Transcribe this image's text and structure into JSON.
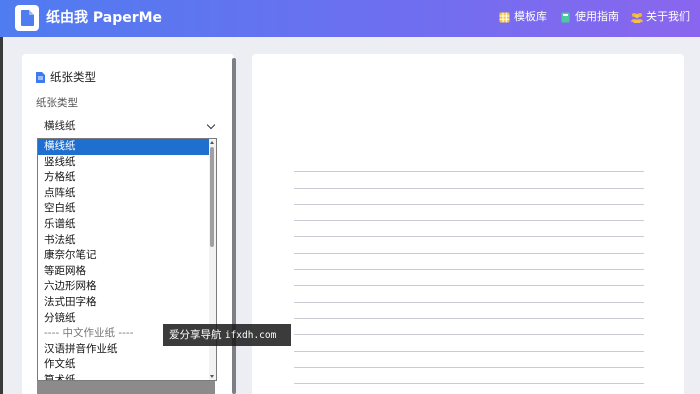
{
  "header": {
    "title": "纸由我 PaperMe",
    "nav": [
      {
        "label": "模板库",
        "icon": "grid-icon"
      },
      {
        "label": "使用指南",
        "icon": "book-icon"
      },
      {
        "label": "关于我们",
        "icon": "users-icon"
      }
    ]
  },
  "sidebar": {
    "section_title": "纸张类型",
    "field_label": "纸张类型",
    "select_value": "横线纸",
    "options": [
      "横线纸",
      "竖线纸",
      "方格纸",
      "点阵纸",
      "空白纸",
      "乐谱纸",
      "书法纸",
      "康奈尔笔记",
      "等距网格",
      "六边形网格",
      "法式田字格",
      "分镜纸",
      "---- 中文作业纸 ----",
      "汉语拼音作业纸",
      "作文纸",
      "算术纸"
    ]
  },
  "watermark": {
    "text": "爱分享导航",
    "domain": "ifxdh.com"
  },
  "colors": {
    "header_start": "#4f7cf0",
    "header_end": "#8a66ee",
    "selected": "#1f6fd0"
  }
}
